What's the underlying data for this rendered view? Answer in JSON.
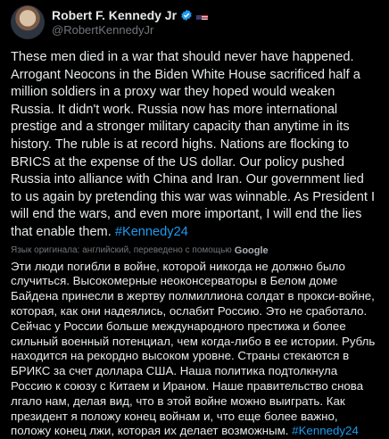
{
  "author": {
    "display_name": "Robert F. Kennedy Jr",
    "handle": "@RobertKennedyJr",
    "verified_icon": "verified-badge-icon",
    "flag_icon": "us-flag-icon"
  },
  "post": {
    "text": "These men died in a war that should never have happened. Arrogant Neocons in the Biden White House sacrificed half a million soldiers in a proxy war they hoped would weaken Russia. It didn't work. Russia now has more international prestige and a stronger military capacity than anytime in its history. The ruble is at record highs. Nations are flocking to BRICS at the expense of the US dollar. Our policy pushed Russia into alliance with China and Iran. Our government lied to us again by pretending this war was winnable. As President I will end the wars, and even more important, I will end the lies that enable them.",
    "hashtag": "#Kennedy24"
  },
  "translation": {
    "note": "Язык оригинала: английский, переведено с помощью",
    "provider": "Google",
    "text": "Эти люди погибли в войне, которой никогда не должно было случиться. Высокомерные неоконсерваторы в Белом доме Байдена принесли в жертву полмиллиона солдат в прокси-войне, которая, как они надеялись, ослабит Россию. Это не сработало. Сейчас у России больше международного престижа и более сильный военный потенциал, чем когда-либо в ее истории. Рубль находится на рекордно высоком уровне. Страны стекаются в БРИКС за счет доллара США. Наша политика подтолкнула Россию к союзу с Китаем и Ираном. Наше правительство снова лгало нам, делая вид, что в этой войне можно выиграть. Как президент я положу конец войнам и, что еще более важно, положу конец лжи, которая их делает возможным.",
    "hashtag": "#Kennedy24"
  },
  "colors": {
    "background": "#000000",
    "text": "#e7e9ea",
    "secondary": "#71767b",
    "accent": "#1d9bf0"
  }
}
